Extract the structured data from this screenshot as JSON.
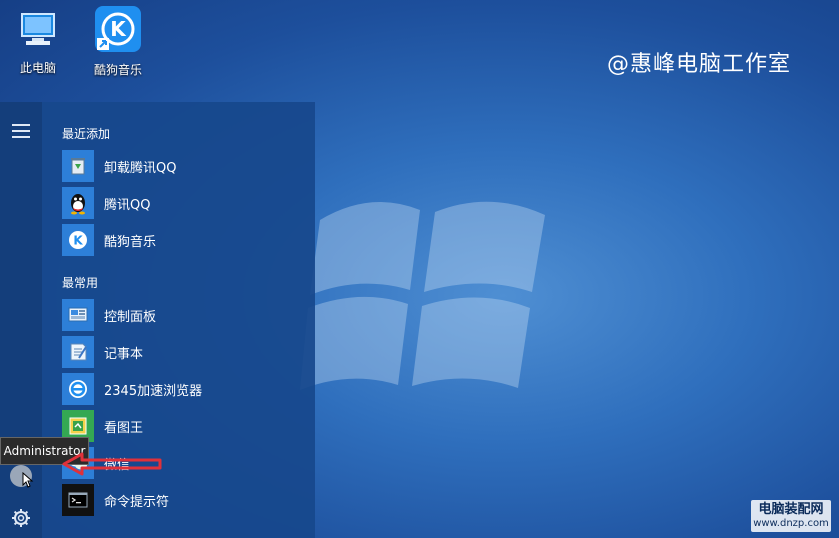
{
  "desktop": {
    "icons": [
      {
        "label": "此电脑",
        "icon": "computer-icon"
      },
      {
        "label": "酷狗音乐",
        "icon": "kugou-icon"
      }
    ],
    "watermark": "@惠峰电脑工作室",
    "corner_mark": {
      "line1": "电脑装配网",
      "line2": "www.dnzp.com"
    }
  },
  "start_menu": {
    "recent_title": "最近添加",
    "recent": [
      {
        "label": "卸载腾讯QQ",
        "icon": "recycle-icon"
      },
      {
        "label": "腾讯QQ",
        "icon": "qq-penguin-icon"
      },
      {
        "label": "酷狗音乐",
        "icon": "kugou-icon"
      }
    ],
    "frequent_title": "最常用",
    "frequent": [
      {
        "label": "控制面板",
        "icon": "control-panel-icon"
      },
      {
        "label": "记事本",
        "icon": "notepad-icon"
      },
      {
        "label": "2345加速浏览器",
        "icon": "browser-icon"
      },
      {
        "label": "看图王",
        "icon": "image-viewer-icon"
      },
      {
        "label": "微信",
        "icon": "wechat-icon"
      },
      {
        "label": "命令提示符",
        "icon": "cmd-icon"
      }
    ]
  },
  "tooltip": {
    "text": "Administrator"
  },
  "colors": {
    "accent": "#2d7fd8",
    "annotation": "#e0313a"
  }
}
